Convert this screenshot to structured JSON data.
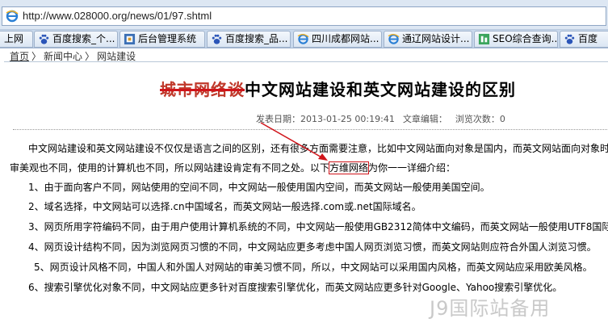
{
  "address": {
    "url": "http://www.028000.org/news/01/97.shtml"
  },
  "tabs": [
    {
      "label": "上网",
      "icon": "paw-icon"
    },
    {
      "label": "百度搜索_个...",
      "icon": "paw-icon"
    },
    {
      "label": "后台管理系统",
      "icon": "page-icon"
    },
    {
      "label": "百度搜索_品...",
      "icon": "paw-icon"
    },
    {
      "label": "四川成都网站...",
      "icon": "ie-icon"
    },
    {
      "label": "通辽网站设计...",
      "icon": "ie-icon"
    },
    {
      "label": "SEO综合查询...",
      "icon": "seo-icon"
    },
    {
      "label": "百度",
      "icon": "paw-icon"
    }
  ],
  "breadcrumb": {
    "home": "首页",
    "sep1": "〉",
    "news": "新闻中心",
    "sep2": "〉",
    "current": "网站建设"
  },
  "article": {
    "title_struck": "城市网络谈",
    "title": "中文网站建设和英文网站建设的区别",
    "date": "发表日期：2013-01-25 00:19:41",
    "editor": "文章编辑：",
    "views": "浏览次数：0",
    "p1": "中文网站建设和英文网站建设不仅仅是语言之间的区别，还有很多方面需要注意，比如中文网站面向对象是国内，而英文网站面向对象时",
    "p2_start": "审美观也不同，使用的计算机也不同，所以网站建设肯定有不同之处。以下",
    "p2_highlight": "方维网络",
    "p2_end": "为你一一详细介绍：",
    "items": [
      "1、由于面向客户不同，网站使用的空间不同，中文网站一般使用国内空间，而英文网站一般使用美国空间。",
      "2、域名选择，中文网站可以选择.cn中国域名，而英文网站一般选择.com或.net国际域名。",
      "3、网页所用字符编码不同，由于用户使用计算机系统的不同，中文网站一般使用GB2312简体中文编码，而英文网站一般使用UTF8国际编",
      "4、网页设计结构不同，因为浏览网页习惯的不同，中文网站应更多考虑中国人网页浏览习惯，而英文网站则应符合外国人浏览习惯。",
      "5、网页设计风格不同，中国人和外国人对网站的审美习惯不同，所以，中文网站可以采用国内风格，而英文网站应采用欧美风格。",
      "6、搜索引擎优化对象不同，中文网站应更多针对百度搜索引擎优化，而英文网站应更多针对Google、Yahoo搜索引擎优化。"
    ]
  },
  "watermark": "J9国际站备用"
}
